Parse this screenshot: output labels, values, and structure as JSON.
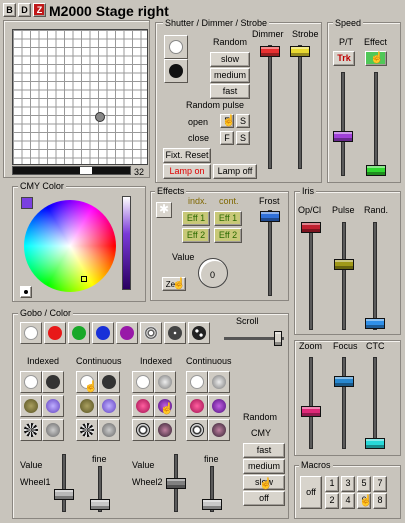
{
  "title": {
    "b": "B",
    "d": "D",
    "z": "Z",
    "text": "M2000 Stage right"
  },
  "pantilt": {
    "bar_value": "32"
  },
  "shutter": {
    "title": "Shutter / Dimmer / Strobe",
    "random": "Random",
    "slow": "slow",
    "medium": "medium",
    "fast": "fast",
    "random_pulse": "Random pulse",
    "open": "open",
    "close": "close",
    "f": "F",
    "s": "S",
    "fixt_reset": "Fixt. Reset",
    "lamp_on": "Lamp on",
    "lamp_off": "Lamp off",
    "dimmer": "Dimmer",
    "strobe": "Strobe"
  },
  "speed": {
    "title": "Speed",
    "pt": "P/T",
    "effect": "Effect",
    "trk": "Trk"
  },
  "cmy": {
    "title": "CMY Color"
  },
  "effects": {
    "title": "Effects",
    "indx": "indx.",
    "cont": "cont.",
    "eff1": "Eff 1",
    "eff2": "Eff 2",
    "frost": "Frost",
    "value": "Value",
    "zero": "Zero",
    "knob": "0"
  },
  "iris": {
    "title": "Iris",
    "opcl": "Op/Cl",
    "pulse": "Pulse",
    "rand": "Rand."
  },
  "gobo": {
    "title": "Gobo / Color",
    "scroll": "Scroll",
    "indexed1": "Indexed",
    "continuous1": "Continuous",
    "indexed2": "Indexed",
    "continuous2": "Continuous",
    "random": "Random",
    "cmy": "CMY",
    "fast": "fast",
    "medium": "medium",
    "slow": "slow",
    "off": "off",
    "value1": "Value",
    "wheel1": "Wheel1",
    "fine1": "fine",
    "value2": "Value",
    "wheel2": "Wheel2",
    "fine2": "fine"
  },
  "zoom": {
    "zoom": "Zoom",
    "focus": "Focus",
    "ctc": "CTC"
  },
  "macros": {
    "title": "Macros",
    "off": "off",
    "m1": "1",
    "m2": "2",
    "m3": "3",
    "m4": "4",
    "m5": "5",
    "m6": "6",
    "m7": "7",
    "m8": "8"
  },
  "colors": {
    "dimmer": "#e83030",
    "strobe": "#e8d830",
    "speed_pt": "#a040d8",
    "effect": "#30d830",
    "frost": "#3070d8",
    "opcl": "#c02030",
    "pulse": "#a09818",
    "rand": "#3090e8",
    "zoom": "#e02878",
    "focus": "#2888d0",
    "ctc": "#28d8d8"
  },
  "swatches": [
    "#ffffff",
    "#e81818",
    "#18a828",
    "#1830d8",
    "#9818a8"
  ]
}
